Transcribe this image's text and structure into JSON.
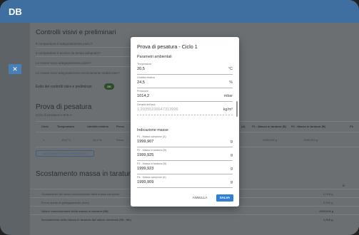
{
  "app": {
    "brand": "DB",
    "side_tab_icon": "close-icon"
  },
  "background": {
    "controls_title": "Controlli visivi e preliminari",
    "controls_items": [
      "Il comparatore è adeguatamente pulito?",
      "Il comparatore è acceso da tempo adeguato?",
      "Le masse sono adeguatamente pulite?",
      "Le masse sono adeguatamente termicamente stabilizzate?"
    ],
    "controls_result_label": "Esito dei controlli visivi e preliminari",
    "controls_result_badge": "OK",
    "weighing_title": "Prova di pesatura",
    "weighing_cycle": "Ciclo di pesatura  A-B-B-A",
    "table_headers": [
      "Ciclo",
      "Temperatura",
      "Umidità relativa",
      "Press",
      "(A)",
      "P1 - Massa in taratura (B)",
      "P2 - Massa in taratura (B)",
      "P3"
    ],
    "table_row": [
      "1",
      "20,5 °C",
      "24,5 %",
      "Press",
      "",
      "1999,925 g",
      "1999,923 g",
      ""
    ],
    "add_cycle_button": "AGGIUNGI CICLO DI PESATURA",
    "scostamento_title": "Scostamento massa in taratura dal v",
    "scostamento_col": "Ü",
    "scostamento_rows": [
      {
        "label": "Scostamento del valore convenzionale della massa campione",
        "value": "0,016 g"
      },
      {
        "label": "Errore spinta di galleggiamento (hmb)",
        "value": "0,000 g"
      },
      {
        "label": "Valore convenzionale della massa in taratura (Mt)",
        "value": "2000,016 g"
      },
      {
        "label": "Scostamento della massa in taratura dal valore nominale (Mt - Mn)",
        "value": "0,016 g"
      }
    ]
  },
  "dialog": {
    "title": "Prova di pesatura - Ciclo 1",
    "section_env": "Parametri ambientali",
    "temperature": {
      "label": "Temperatura",
      "value": "20,5",
      "unit": "°C"
    },
    "humidity": {
      "label": "Umidità relativa",
      "value": "24,5",
      "unit": "%"
    },
    "pressure": {
      "label": "Pressione",
      "value": "1014,2",
      "unit": "mbar"
    },
    "density": {
      "label": "Densità dell'aria",
      "value": "1,20355236647313996",
      "unit": "kg/m³"
    },
    "section_mass": "Indicazione masse",
    "masses": [
      {
        "label": "P1 - Massa campione (A)",
        "value": "1999,907",
        "unit": "g"
      },
      {
        "label": "P2 - Massa in taratura (B)",
        "value": "1999,925",
        "unit": "g"
      },
      {
        "label": "P3 - Massa in taratura (B)",
        "value": "1999,923",
        "unit": "g"
      },
      {
        "label": "P4 - Massa campione (A)",
        "value": "1999,909",
        "unit": "g"
      }
    ],
    "cancel_button": "ANNULLA",
    "save_button": "SALVA"
  },
  "colors": {
    "accent": "#2e80d6",
    "topbar": "#3f6fa0",
    "ok_badge": "#2c4d2a"
  }
}
